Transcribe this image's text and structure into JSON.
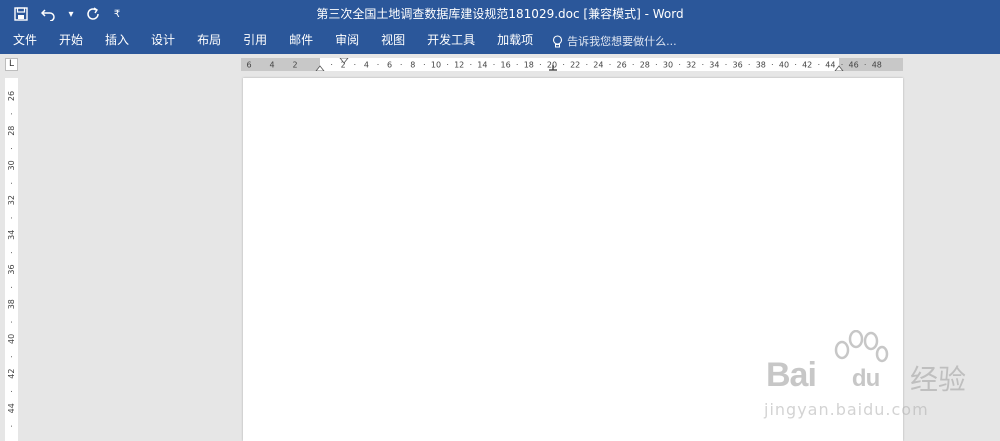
{
  "window": {
    "title": "第三次全国土地调查数据库建设规范181029.doc [兼容模式] - Word"
  },
  "quick_access": {
    "icons": [
      "save-icon",
      "undo-icon",
      "dropdown-icon",
      "redo-icon",
      "customize-icon"
    ],
    "dropdown_glyph": "▾",
    "customize_glyph": "₹"
  },
  "ribbon": {
    "tabs": [
      "文件",
      "开始",
      "插入",
      "设计",
      "布局",
      "引用",
      "邮件",
      "审阅",
      "视图",
      "开发工具",
      "加载项"
    ],
    "tell_me_placeholder": "告诉我您想要做什么..."
  },
  "ruler": {
    "corner_glyph": "L",
    "left_margin_ticks": [
      "6",
      "4",
      "2"
    ],
    "ticks": [
      "2",
      "4",
      "6",
      "8",
      "10",
      "12",
      "14",
      "16",
      "18",
      "20",
      "22",
      "24",
      "26",
      "28",
      "30",
      "32",
      "34",
      "36",
      "38",
      "40",
      "42",
      "44",
      "46",
      "48"
    ],
    "vertical_ticks": [
      "26",
      "28",
      "30",
      "32",
      "34",
      "36",
      "38",
      "40",
      "42",
      "44"
    ]
  },
  "watermark": {
    "brand": "Bai",
    "brand2": "du",
    "product": "经验",
    "url": "jingyan.baidu.com"
  },
  "colors": {
    "ribbon": "#2b579a",
    "workspace": "#e6e6e6"
  }
}
